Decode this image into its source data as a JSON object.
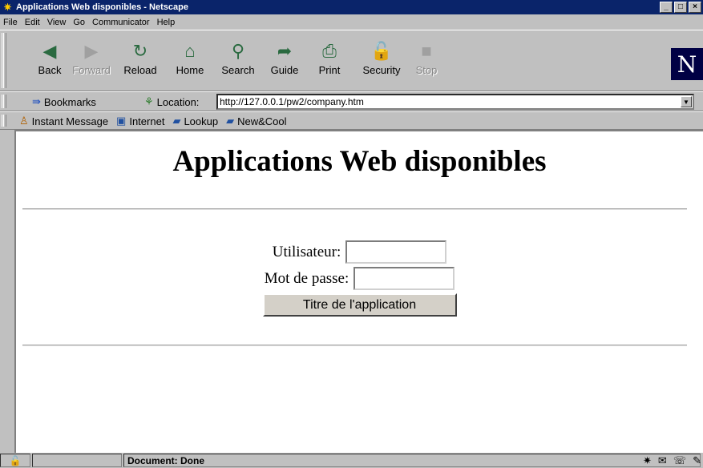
{
  "window": {
    "title": "Applications Web disponibles - Netscape"
  },
  "menu": [
    "File",
    "Edit",
    "View",
    "Go",
    "Communicator",
    "Help"
  ],
  "nav": [
    {
      "label": "Back",
      "icon": "back-icon",
      "glyph": "◀",
      "enabled": true
    },
    {
      "label": "Forward",
      "icon": "forward-icon",
      "glyph": "▶",
      "enabled": false
    },
    {
      "label": "Reload",
      "icon": "reload-icon",
      "glyph": "↻",
      "enabled": true
    },
    {
      "label": "Home",
      "icon": "home-icon",
      "glyph": "⌂",
      "enabled": true
    },
    {
      "label": "Search",
      "icon": "search-icon",
      "glyph": "⚲",
      "enabled": true
    },
    {
      "label": "Guide",
      "icon": "guide-icon",
      "glyph": "➦",
      "enabled": true
    },
    {
      "label": "Print",
      "icon": "print-icon",
      "glyph": "⎙",
      "enabled": true
    },
    {
      "label": "Security",
      "icon": "security-icon",
      "glyph": "🔓",
      "enabled": true
    },
    {
      "label": "Stop",
      "icon": "stop-icon",
      "glyph": "■",
      "enabled": false
    }
  ],
  "location": {
    "bookmarks_label": "Bookmarks",
    "label": "Location:",
    "url": "http://127.0.0.1/pw2/company.htm"
  },
  "personal": [
    {
      "label": "Instant Message",
      "icon": "instant-message-icon",
      "glyph": "♙"
    },
    {
      "label": "Internet",
      "icon": "internet-icon",
      "glyph": "▣"
    },
    {
      "label": "Lookup",
      "icon": "folder-icon",
      "glyph": "▰"
    },
    {
      "label": "New&Cool",
      "icon": "folder-icon",
      "glyph": "▰"
    }
  ],
  "page": {
    "title": "Applications Web disponibles",
    "user_label": "Utilisateur:",
    "user_value": "",
    "password_label": "Mot de passe:",
    "password_value": "",
    "submit_label": "Titre de l'application"
  },
  "status": {
    "text": "Document: Done"
  }
}
